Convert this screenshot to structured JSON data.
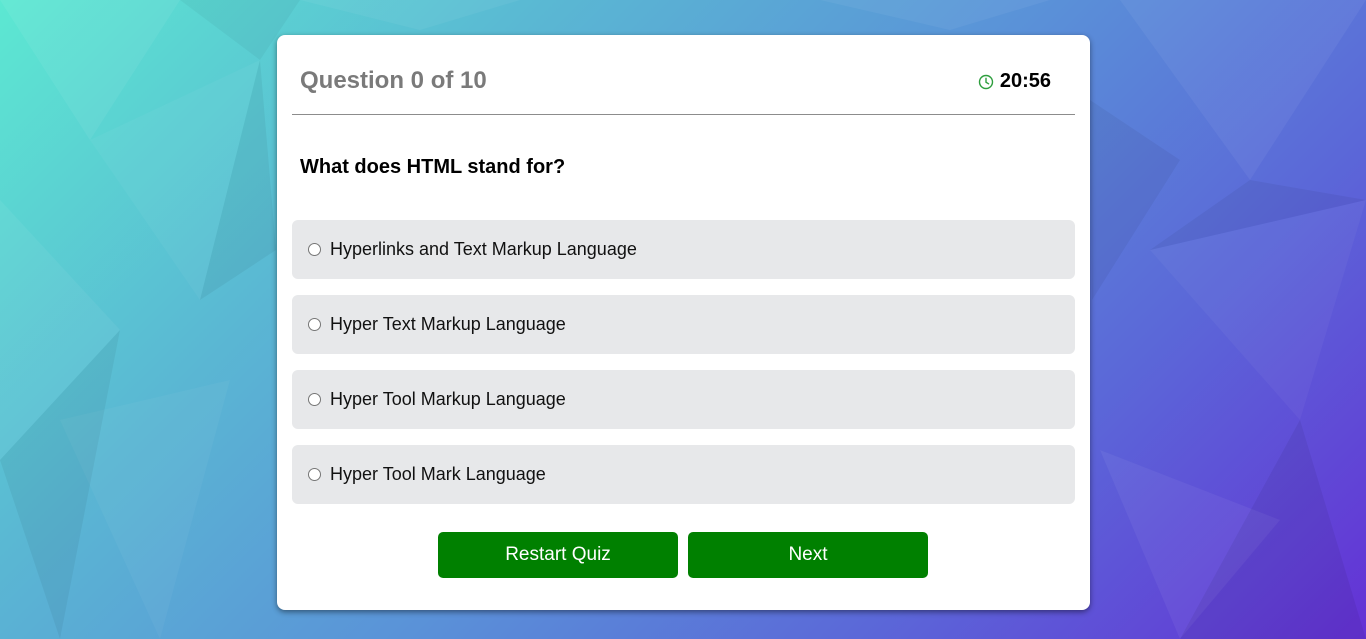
{
  "quiz": {
    "counter_label": "Question 0 of 10",
    "timer": {
      "icon": "clock-icon",
      "value": "20:56"
    },
    "question": "What does HTML stand for?",
    "options": [
      {
        "label": "Hyperlinks and Text Markup Language",
        "selected": false
      },
      {
        "label": "Hyper Text Markup Language",
        "selected": false
      },
      {
        "label": "Hyper Tool Markup Language",
        "selected": false
      },
      {
        "label": "Hyper Tool Mark Language",
        "selected": false
      }
    ],
    "buttons": {
      "restart_label": "Restart Quiz",
      "next_label": "Next"
    }
  },
  "colors": {
    "button": "#008000",
    "timer_icon": "#2e9e3e",
    "option_bg": "#e7e8ea",
    "counter_text": "#7a7a7a"
  }
}
